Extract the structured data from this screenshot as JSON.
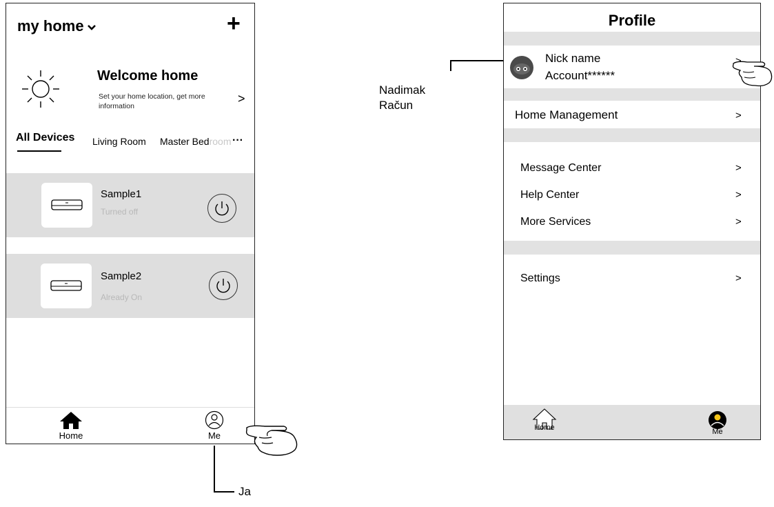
{
  "home_screen": {
    "home_title": "my home",
    "add_symbol": "+",
    "welcome": {
      "title": "Welcome home",
      "subtitle_line1": "Set your home location, get more",
      "subtitle_line2": "information",
      "arrow": ">"
    },
    "tabs": [
      {
        "label": "All Devices"
      },
      {
        "label": "Living Room"
      },
      {
        "label": "Master Bed"
      },
      {
        "label": "room"
      }
    ],
    "more_symbol": "···",
    "devices": [
      {
        "name": "Sample1",
        "status": "Turned off"
      },
      {
        "name": "Sample2",
        "status": "Already On"
      }
    ],
    "nav": {
      "home_label": "Home",
      "me_label": "Me"
    }
  },
  "profile_screen": {
    "title": "Profile",
    "account": {
      "nick_name": "Nick name",
      "account_text": "Account******",
      "arrow": ">"
    },
    "home_management": {
      "label": "Home Management",
      "arrow": ">"
    },
    "menu_items": [
      {
        "label": "Message Center",
        "arrow": ">"
      },
      {
        "label": "Help Center",
        "arrow": ">"
      },
      {
        "label": "More Services",
        "arrow": ">"
      }
    ],
    "settings": {
      "label": "Settings",
      "arrow": ">"
    },
    "nav": {
      "home_label": "Home",
      "me_label": "Me"
    }
  },
  "annotations": {
    "nickname_label": "Nadimak",
    "account_label": "Račun",
    "me_label": "Ja"
  },
  "colors": {
    "card_bg": "#dedede",
    "gap_bg": "#e2e2e2",
    "nav_bg_profile": "#e0e0e0",
    "status_gray": "#b8b8b8",
    "me_active": "#000000",
    "me_dot": "#f5c518"
  }
}
